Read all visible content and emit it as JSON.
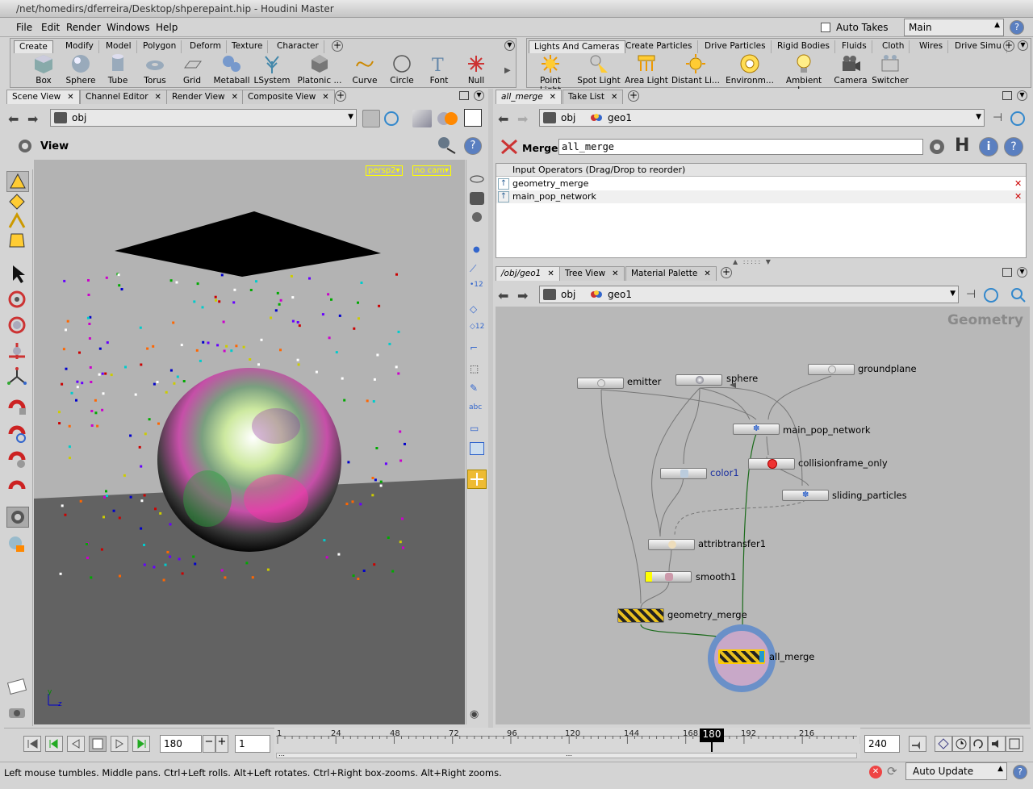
{
  "window": {
    "title": "/net/homedirs/dferreira/Desktop/shperepaint.hip - Houdini Master"
  },
  "menubar": {
    "items": [
      "File",
      "Edit",
      "Render",
      "Windows",
      "Help"
    ],
    "auto_takes": "Auto Takes",
    "take": "Main"
  },
  "shelf_left": {
    "tabs": [
      "Create",
      "Modify",
      "Model",
      "Polygon",
      "Deform",
      "Texture",
      "Character"
    ],
    "tools": [
      "Box",
      "Sphere",
      "Tube",
      "Torus",
      "Grid",
      "Metaball",
      "LSystem",
      "Platonic ...",
      "Curve",
      "Circle",
      "Font",
      "Null"
    ]
  },
  "shelf_right": {
    "tabs": [
      "Lights And Cameras",
      "Create Particles",
      "Drive Particles",
      "Rigid Bodies",
      "Fluids",
      "Cloth",
      "Wires",
      "Drive Simu"
    ],
    "tools": [
      "Point Light",
      "Spot Light",
      "Area Light",
      "Distant Li...",
      "Environm...",
      "Ambient L...",
      "Camera",
      "Switcher"
    ]
  },
  "scene": {
    "tabs": [
      "Scene View",
      "Channel Editor",
      "Render View",
      "Composite View"
    ],
    "path": "obj",
    "view_label": "View",
    "cam_persp": "persp2▾",
    "cam_none": "no cam▾",
    "axis_y": "y",
    "axis_z": "z"
  },
  "params": {
    "tabs": [
      "all_merge",
      "Take List"
    ],
    "path": [
      "obj",
      "geo1"
    ],
    "node_type": "Merge",
    "node_name": "all_merge",
    "list_header": "Input Operators (Drag/Drop to reorder)",
    "inputs": [
      "geometry_merge",
      "main_pop_network"
    ]
  },
  "network": {
    "tabs": [
      "/obj/geo1",
      "Tree View",
      "Material Palette"
    ],
    "path": [
      "obj",
      "geo1"
    ],
    "context_label": "Geometry",
    "nodes": {
      "emitter": "emitter",
      "sphere": "sphere",
      "groundplane": "groundplane",
      "main_pop_network": "main_pop_network",
      "collisionframe_only": "collisionframe_only",
      "color1": "color1",
      "sliding_particles": "sliding_particles",
      "attribtransfer1": "attribtransfer1",
      "smooth1": "smooth1",
      "geometry_merge": "geometry_merge",
      "all_merge": "all_merge"
    }
  },
  "timeline": {
    "frame": "180",
    "step": "1",
    "ticks": [
      "1",
      "24",
      "48",
      "72",
      "96",
      "120",
      "144",
      "168",
      "192",
      "216"
    ],
    "current": "180",
    "end": "240"
  },
  "status": {
    "message": "Left mouse tumbles. Middle pans. Ctrl+Left rolls. Alt+Left rotates. Ctrl+Right box-zooms. Alt+Right zooms.",
    "update_mode": "Auto Update"
  }
}
